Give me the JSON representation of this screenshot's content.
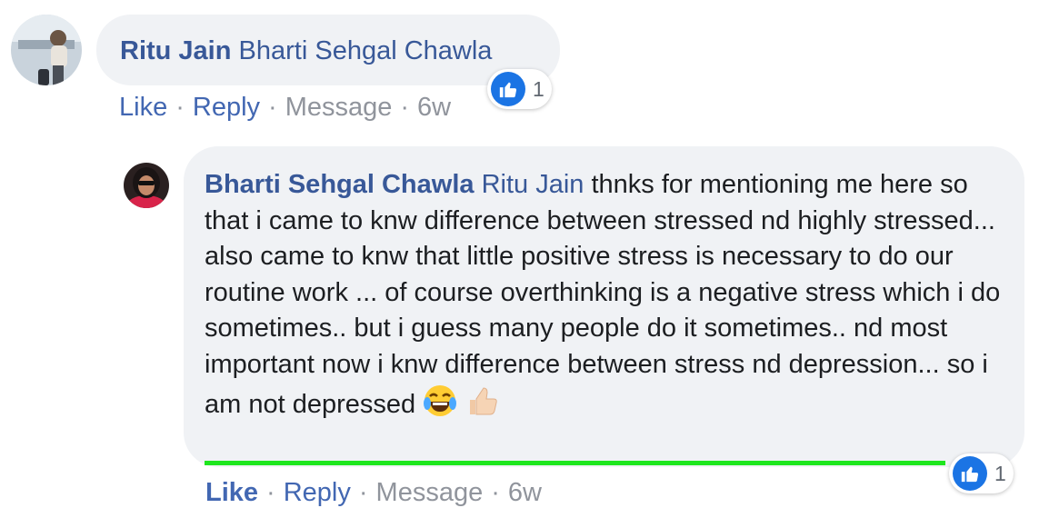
{
  "comment1": {
    "author": "Ritu Jain",
    "mention": "Bharti Sehgal Chawla",
    "actions": {
      "like": "Like",
      "reply": "Reply",
      "message": "Message",
      "time": "6w"
    },
    "reaction_count": "1",
    "reaction_icon": "like-icon"
  },
  "comment2": {
    "author": "Bharti Sehgal Chawla",
    "mention": "Ritu Jain",
    "text": "thnks for mentioning me here so that i came to knw difference between stressed nd highly stressed... also came to knw that little positive stress is necessary to do our routine work ... of course overthinking is a negative stress which i do sometimes.. but i guess many people do it sometimes.. nd most important now i knw difference between stress nd depression... so i am not depressed",
    "emojis": [
      "tears-of-joy-emoji",
      "thumbs-up-emoji"
    ],
    "actions": {
      "like": "Like",
      "reply": "Reply",
      "message": "Message",
      "time": "6w"
    },
    "reaction_count": "1",
    "reaction_icon": "like-icon"
  },
  "colors": {
    "link": "#385898",
    "action": "#4267b2",
    "muted": "#90949c",
    "bubble": "#f0f2f5",
    "like_blue": "#1b74e4",
    "highlight_line": "#1ee61e"
  }
}
